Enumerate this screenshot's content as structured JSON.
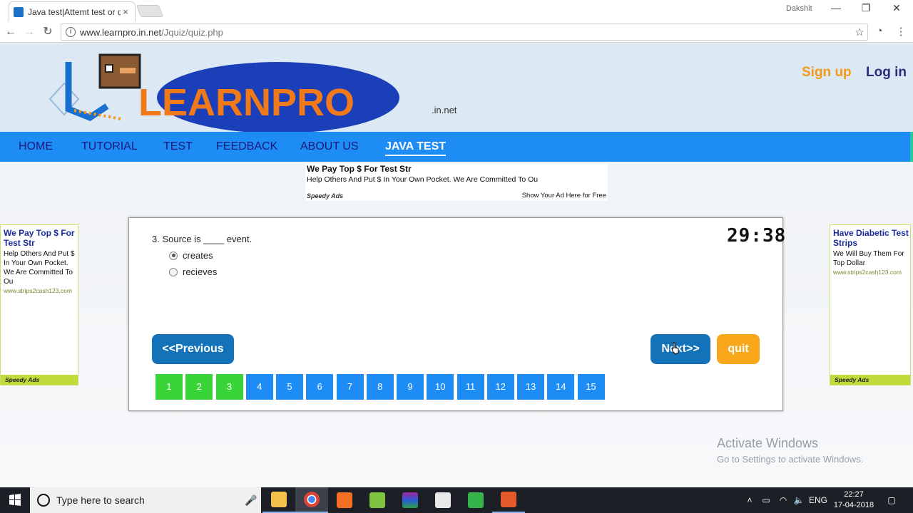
{
  "browser": {
    "tab_title": "Java test|Attemt test or q",
    "tab_close": "×",
    "user_name": "Dakshit",
    "window_buttons": [
      "—",
      "❐",
      "✕"
    ],
    "url_host": "www.learnpro.in.net",
    "url_path": "/Jquiz/quiz.php"
  },
  "site": {
    "logo_text": "LEARNPRO",
    "logo_suffix": ".in.net",
    "signup": "Sign up",
    "login": "Log in",
    "menu": [
      "HOME",
      "TUTORIAL",
      "TEST",
      "FEEDBACK",
      "ABOUT US",
      "JAVA TEST"
    ],
    "active_menu": "JAVA TEST"
  },
  "ads": {
    "top": {
      "headline": "We Pay Top $ For Test Str",
      "body": "Help Others And Put $ In Your Own Pocket. We Are Committed To Ou",
      "brand": "Speedy Ads",
      "cta": "Show Your Ad Here for Free"
    },
    "left": {
      "headline": "We Pay Top $ For Test Str",
      "body": "Help Others And Put $ In Your Own Pocket. We Are Committed To Ou",
      "url": "www.strips2cash123.com",
      "brand": "Speedy Ads"
    },
    "right": {
      "headline": "Have Diabetic Test Strips",
      "body": "We Will Buy Them For Top Dollar",
      "url": "www.strips2cash123.com",
      "brand": "Speedy Ads"
    }
  },
  "quiz": {
    "question": "3. Source is ____ event.",
    "options": [
      "creates",
      "recieves"
    ],
    "selected_option": "creates",
    "timer": "29:38",
    "prev_label": "<<Previous",
    "next_label": "Next>>",
    "quit_label": "quit",
    "pages": [
      "1",
      "2",
      "3",
      "4",
      "5",
      "6",
      "7",
      "8",
      "9",
      "10",
      "11",
      "12",
      "13",
      "14",
      "15"
    ],
    "answered_pages": 3
  },
  "watermark": {
    "line1": "Activate Windows",
    "line2": "Go to Settings to activate Windows."
  },
  "taskbar": {
    "search_placeholder": "Type here to search",
    "lang": "ENG",
    "time": "22:27",
    "date": "17-04-2018"
  },
  "colors": {
    "menu_bar": "#1e8cf5",
    "answered": "#38d438",
    "unanswered": "#1e8cf5",
    "nav_button": "#1473b8",
    "quit_button": "#f8a71a",
    "signup": "#f39a1a"
  }
}
